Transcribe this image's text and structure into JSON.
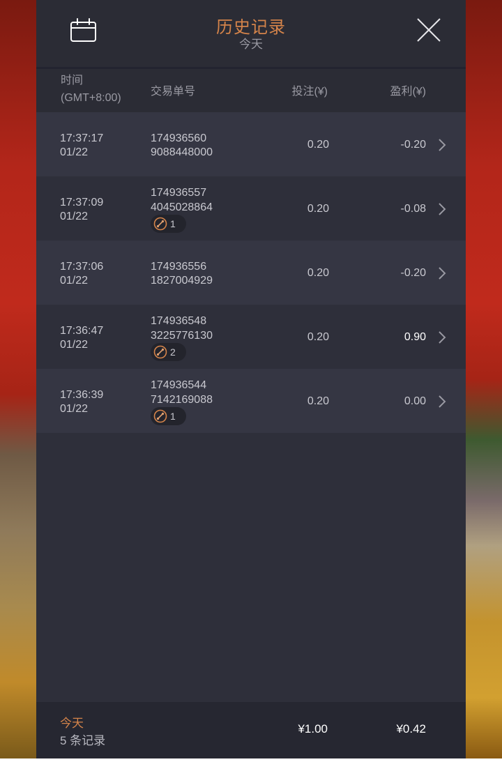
{
  "header": {
    "title": "历史记录",
    "subtitle": "今天",
    "calendar_icon": "calendar-icon",
    "close_icon": "close-icon"
  },
  "columns": {
    "time": "时间",
    "timezone": "(GMT+8:00)",
    "order": "交易单号",
    "bet": "投注(¥)",
    "profit": "盈利(¥)"
  },
  "rows": [
    {
      "time": "17:37:17",
      "date": "01/22",
      "order_line1": "174936560",
      "order_line2": "9088448000",
      "badge": null,
      "bet": "0.20",
      "profit": "-0.20"
    },
    {
      "time": "17:37:09",
      "date": "01/22",
      "order_line1": "174936557",
      "order_line2": "4045028864",
      "badge": "1",
      "bet": "0.20",
      "profit": "-0.08"
    },
    {
      "time": "17:37:06",
      "date": "01/22",
      "order_line1": "174936556",
      "order_line2": "1827004929",
      "badge": null,
      "bet": "0.20",
      "profit": "-0.20"
    },
    {
      "time": "17:36:47",
      "date": "01/22",
      "order_line1": "174936548",
      "order_line2": "3225776130",
      "badge": "2",
      "bet": "0.20",
      "profit": "0.90"
    },
    {
      "time": "17:36:39",
      "date": "01/22",
      "order_line1": "174936544",
      "order_line2": "7142169088",
      "badge": "1",
      "bet": "0.20",
      "profit": "0.00"
    }
  ],
  "footer": {
    "label": "今天",
    "count": "5 条记录",
    "total_bet": "¥1.00",
    "total_profit": "¥0.42"
  },
  "colors": {
    "accent": "#d5844a",
    "panel": "#2e2f3a",
    "row_alt": "#353643",
    "text": "#c9c9d0"
  }
}
